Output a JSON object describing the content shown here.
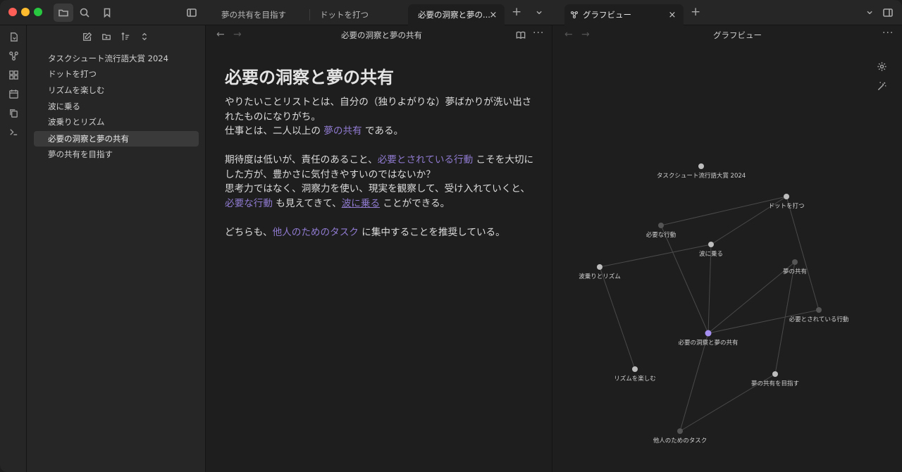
{
  "titlebar": {
    "tabs": [
      {
        "label": "夢の共有を目指す"
      },
      {
        "label": "ドットを打つ"
      },
      {
        "label": "必要の洞察と夢の..."
      },
      {
        "label": "グラフビュー"
      }
    ],
    "close_glyph": "×",
    "new_tab_glyph": "+",
    "dropdown_glyph": "⌄"
  },
  "explorer": {
    "files": [
      {
        "label": "タスクシュート流行語大賞 2024"
      },
      {
        "label": "ドットを打つ"
      },
      {
        "label": "リズムを楽しむ"
      },
      {
        "label": "波に乗る"
      },
      {
        "label": "波乗りとリズム"
      },
      {
        "label": "必要の洞察と夢の共有"
      },
      {
        "label": "夢の共有を目指す"
      }
    ]
  },
  "editor": {
    "back_glyph": "←",
    "forward_glyph": "→",
    "more_glyph": "···",
    "title": "必要の洞察と夢の共有",
    "heading": "必要の洞察と夢の共有",
    "p1": {
      "a": "やりたいことリストとは、自分の（独りよがりな）夢ばかりが洗い出さ",
      "b": "れたものになりがち。",
      "c": "仕事とは、二人以上の ",
      "link": "夢の共有",
      "d": " である。"
    },
    "p2": {
      "a": "期待度は低いが、責任のあること、",
      "link1": "必要とされている行動",
      "b": " こそを大切に",
      "c": "した方が、豊かさに気付きやすいのではないか？",
      "d": "思考力ではなく、洞察力を使い、現実を観察して、受け入れていくと、",
      "link2": "必要な行動",
      "e": " も見えてきて、",
      "link3": "波に乗る",
      "f": " ことができる。"
    },
    "p3": {
      "a": "どちらも、",
      "link": "他人のためのタスク",
      "b": " に集中することを推奨している。"
    }
  },
  "graph": {
    "title": "グラフビュー",
    "more_glyph": "···",
    "back_glyph": "←",
    "forward_glyph": "→",
    "nodes": [
      {
        "label": "タスクシュート流行語大賞 2024",
        "state": "existing"
      },
      {
        "label": "ドットを打つ",
        "state": "existing"
      },
      {
        "label": "必要な行動",
        "state": "unresolved"
      },
      {
        "label": "波に乗る",
        "state": "existing"
      },
      {
        "label": "波乗りとリズム",
        "state": "existing"
      },
      {
        "label": "夢の共有",
        "state": "unresolved"
      },
      {
        "label": "必要とされている行動",
        "state": "unresolved"
      },
      {
        "label": "必要の洞察と夢の共有",
        "state": "active"
      },
      {
        "label": "リズムを楽しむ",
        "state": "existing"
      },
      {
        "label": "夢の共有を目指す",
        "state": "existing"
      },
      {
        "label": "他人のためのタスク",
        "state": "unresolved"
      }
    ],
    "edges": [
      [
        1,
        2
      ],
      [
        1,
        3
      ],
      [
        1,
        6
      ],
      [
        3,
        4
      ],
      [
        3,
        7
      ],
      [
        2,
        7
      ],
      [
        4,
        8
      ],
      [
        5,
        7
      ],
      [
        5,
        9
      ],
      [
        6,
        7
      ],
      [
        7,
        10
      ],
      [
        9,
        10
      ]
    ]
  },
  "colors": {
    "accent": "#8f7ad0",
    "active_node": "#a58ff0",
    "node_existing": "#bdbdbd",
    "node_unresolved": "#555555",
    "edge": "#4a4a4a"
  }
}
